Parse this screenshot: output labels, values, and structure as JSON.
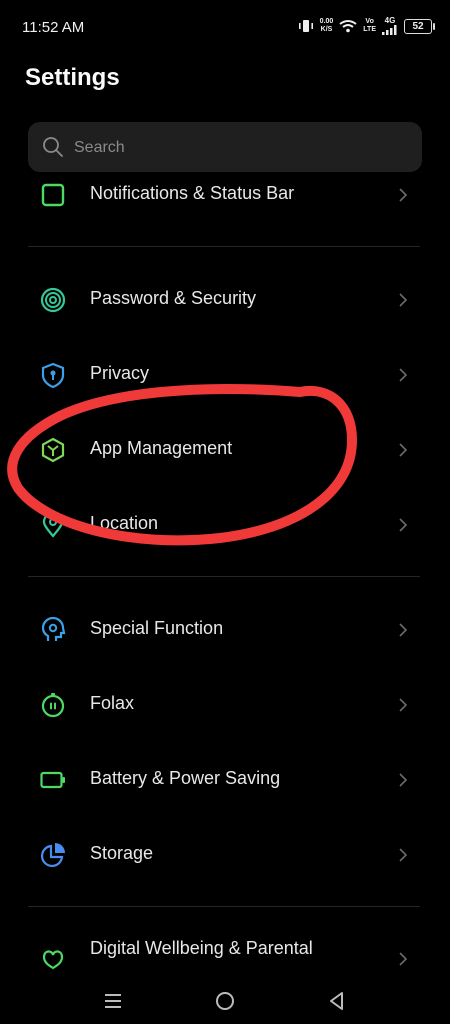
{
  "status_bar": {
    "time": "11:52 AM",
    "net_speed_value": "0.00",
    "net_speed_unit": "K/S",
    "volte_top": "Vo",
    "volte_bottom": "LTE",
    "network": "4G",
    "battery": "52",
    "icons": [
      "vibrate-icon",
      "wifi-icon",
      "signal-icon",
      "battery-icon"
    ]
  },
  "page": {
    "title": "Settings"
  },
  "search": {
    "placeholder": "Search"
  },
  "items": [
    {
      "label": "Notifications & Status Bar",
      "icon": "notification-icon",
      "color": "#4cd964"
    },
    {
      "label": "Password & Security",
      "icon": "fingerprint-icon",
      "color": "#34c79a"
    },
    {
      "label": "Privacy",
      "icon": "shield-icon",
      "color": "#3aa0e8"
    },
    {
      "label": "App Management",
      "icon": "box-icon",
      "color": "#7ed957"
    },
    {
      "label": "Location",
      "icon": "location-icon",
      "color": "#34c79a"
    },
    {
      "label": "Special Function",
      "icon": "head-icon",
      "color": "#3aa0e8"
    },
    {
      "label": "Folax",
      "icon": "folax-icon",
      "color": "#4cd964"
    },
    {
      "label": "Battery & Power Saving",
      "icon": "battery-icon",
      "color": "#4cd964"
    },
    {
      "label": "Storage",
      "icon": "pie-chart-icon",
      "color": "#4a8cf0"
    },
    {
      "label": "Digital Wellbeing & Parental",
      "icon": "wellbeing-icon",
      "color": "#4cd964"
    }
  ],
  "annotation_color": "#f03a3a",
  "nav_icons": [
    "menu-icon",
    "home-icon",
    "back-icon"
  ]
}
